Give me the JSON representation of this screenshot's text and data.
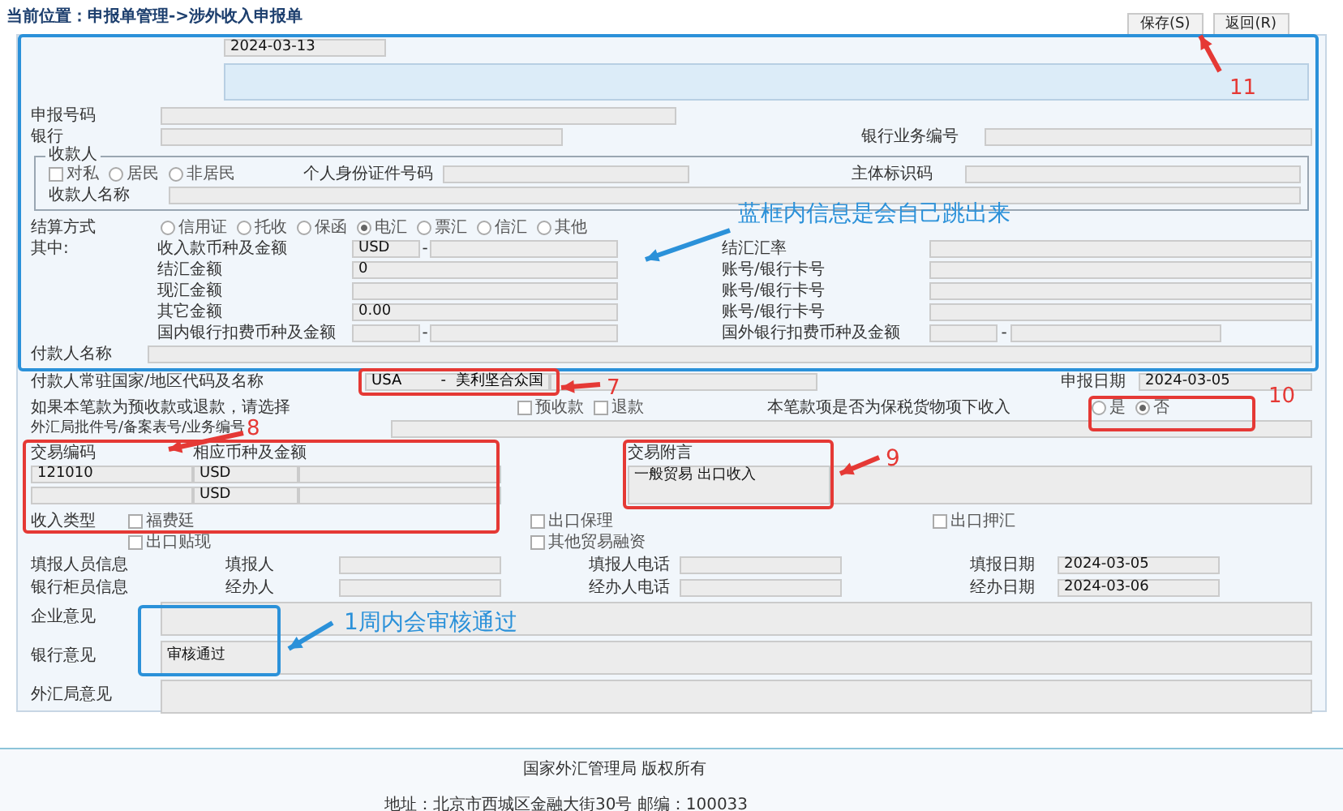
{
  "breadcrumb": "当前位置：申报单管理->涉外收入申报单",
  "toolbar": [
    {
      "label": "保存(S)"
    },
    {
      "label": "返回(R)"
    }
  ],
  "header": {
    "date": "2024-03-13"
  },
  "declaration_no": {
    "label": "申报号码"
  },
  "bank": {
    "label": "银行",
    "ref_label": "银行业务编号"
  },
  "payee": {
    "legend": "收款人",
    "types": [
      {
        "label": "对私",
        "kind": "checkbox",
        "selected": false
      },
      {
        "label": "居民",
        "kind": "radio",
        "selected": false
      },
      {
        "label": "非居民",
        "kind": "radio",
        "selected": false
      }
    ],
    "id_label": "个人身份证件号码",
    "org_label": "主体标识码",
    "name_label": "收款人名称"
  },
  "settlement": {
    "label": "结算方式",
    "methods": [
      {
        "label": "信用证",
        "selected": false
      },
      {
        "label": "托收",
        "selected": false
      },
      {
        "label": "保函",
        "selected": false
      },
      {
        "label": "电汇",
        "selected": true
      },
      {
        "label": "票汇",
        "selected": false
      },
      {
        "label": "信汇",
        "selected": false
      },
      {
        "label": "其他",
        "selected": false
      }
    ]
  },
  "breakdown": {
    "label": "其中:",
    "separator": "-",
    "rows": [
      {
        "label": "收入款币种及金额",
        "kind": "split",
        "currency": "USD",
        "right_label": "结汇汇率"
      },
      {
        "label": "结汇金额",
        "kind": "single",
        "amount": "0",
        "right_label": "账号/银行卡号"
      },
      {
        "label": "现汇金额",
        "kind": "single",
        "right_label": "账号/银行卡号"
      },
      {
        "label": "其它金额",
        "kind": "single",
        "amount": "0.00",
        "right_label": "账号/银行卡号"
      },
      {
        "label": "国内银行扣费币种及金额",
        "kind": "split_both",
        "right_label": "国外银行扣费币种及金额"
      }
    ]
  },
  "payer_name_label": "付款人名称",
  "country": {
    "label": "付款人常驻国家/地区代码及名称",
    "code": "USA",
    "separator": "-",
    "name": "美利坚合众国"
  },
  "declare_date": {
    "label": "申报日期",
    "value": "2024-03-05"
  },
  "refund": {
    "label": "如果本笔款为预收款或退款，请选择",
    "options": [
      {
        "label": "预收款",
        "checked": false
      },
      {
        "label": "退款",
        "checked": false
      }
    ]
  },
  "bonded": {
    "label": "本笔款项是否为保税货物项下收入",
    "options": [
      {
        "label": "是",
        "selected": false
      },
      {
        "label": "否",
        "selected": true
      }
    ]
  },
  "approval_label": "外汇局批件号/备案表号/业务编号",
  "transactions": {
    "code_label": "交易编码",
    "amount_label": "相应币种及金额",
    "remark_label": "交易附言",
    "rows": [
      {
        "code": "121010",
        "currency": "USD",
        "remark": "一般贸易 出口收入"
      },
      {
        "currency": "USD"
      }
    ]
  },
  "income_types": {
    "label": "收入类型",
    "options": [
      {
        "label": "福费廷",
        "checked": false
      },
      {
        "label": "出口保理",
        "checked": false
      },
      {
        "label": "出口押汇",
        "checked": false
      },
      {
        "label": "出口贴现",
        "checked": false
      },
      {
        "label": "其他贸易融资",
        "checked": false
      }
    ]
  },
  "staff": [
    {
      "group": "填报人员信息",
      "person_label": "填报人",
      "phone_label": "填报人电话",
      "date_label": "填报日期",
      "date": "2024-03-05"
    },
    {
      "group": "银行柜员信息",
      "person_label": "经办人",
      "phone_label": "经办人电话",
      "date_label": "经办日期",
      "date": "2024-03-06"
    }
  ],
  "opinions": [
    {
      "label": "企业意见"
    },
    {
      "label": "银行意见",
      "value": "审核通过"
    },
    {
      "label": "外汇局意见"
    }
  ],
  "footer": {
    "copyright": "国家外汇管理局 版权所有",
    "address": "地址：北京市西城区金融大街30号 邮编：100033"
  },
  "annotations": [
    {
      "kind": "frame",
      "color": "#2b91d9"
    },
    {
      "kind": "arrow",
      "color": "#e53935"
    },
    {
      "kind": "note",
      "text": "11",
      "color": "#e53935"
    },
    {
      "kind": "note",
      "text": "蓝框内信息是会自己跳出来",
      "color": "#2b91d9"
    },
    {
      "kind": "arrow",
      "color": "#2b91d9"
    },
    {
      "kind": "frame",
      "color": "#e53935"
    },
    {
      "kind": "arrow",
      "color": "#e53935"
    },
    {
      "kind": "note",
      "text": "7",
      "color": "#e53935"
    },
    {
      "kind": "note",
      "text": "10",
      "color": "#e53935"
    },
    {
      "kind": "frame",
      "color": "#e53935"
    },
    {
      "kind": "note",
      "text": "8",
      "color": "#e53935"
    },
    {
      "kind": "arrow",
      "color": "#e53935"
    },
    {
      "kind": "frame",
      "color": "#e53935"
    },
    {
      "kind": "frame",
      "color": "#e53935"
    },
    {
      "kind": "arrow",
      "color": "#e53935"
    },
    {
      "kind": "note",
      "text": "9",
      "color": "#e53935"
    },
    {
      "kind": "note",
      "text": "1周内会审核通过",
      "color": "#2b91d9"
    },
    {
      "kind": "arrow",
      "color": "#2b91d9"
    },
    {
      "kind": "frame",
      "color": "#2b91d9"
    }
  ]
}
